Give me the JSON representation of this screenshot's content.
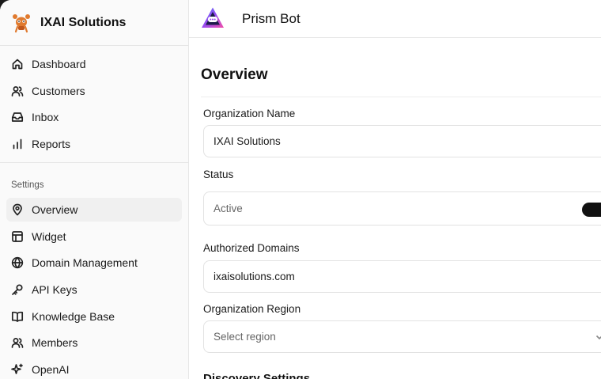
{
  "sidebar": {
    "brand": {
      "name": "IXAI Solutions",
      "logo_icon": "mascot-logo-icon"
    },
    "main_items": [
      {
        "label": "Dashboard",
        "icon": "home-icon"
      },
      {
        "label": "Customers",
        "icon": "users-icon"
      },
      {
        "label": "Inbox",
        "icon": "inbox-icon"
      },
      {
        "label": "Reports",
        "icon": "bar-chart-icon"
      }
    ],
    "settings_label": "Settings",
    "settings_items": [
      {
        "label": "Overview",
        "icon": "map-pin-icon",
        "active": true
      },
      {
        "label": "Widget",
        "icon": "layout-icon"
      },
      {
        "label": "Domain Management",
        "icon": "globe-icon"
      },
      {
        "label": "API Keys",
        "icon": "key-icon"
      },
      {
        "label": "Knowledge Base",
        "icon": "book-icon"
      },
      {
        "label": "Members",
        "icon": "users-icon"
      },
      {
        "label": "OpenAI",
        "icon": "sparkles-icon"
      }
    ]
  },
  "header": {
    "bot_name": "Prism Bot",
    "bot_logo_icon": "prism-bot-logo-icon"
  },
  "main": {
    "page_title": "Overview",
    "org_name": {
      "label": "Organization Name",
      "value": "IXAI Solutions"
    },
    "status": {
      "label": "Status",
      "value": "Active",
      "enabled": true
    },
    "domains": {
      "label": "Authorized Domains",
      "value": "ixaisolutions.com"
    },
    "region": {
      "label": "Organization Region",
      "placeholder": "Select region"
    },
    "next_section_title": "Discovery Settings"
  },
  "colors": {
    "accent": "#111111",
    "sidebar_bg": "#fafafa",
    "border": "#e6e6e6",
    "active_bg": "#f0f0f0"
  }
}
